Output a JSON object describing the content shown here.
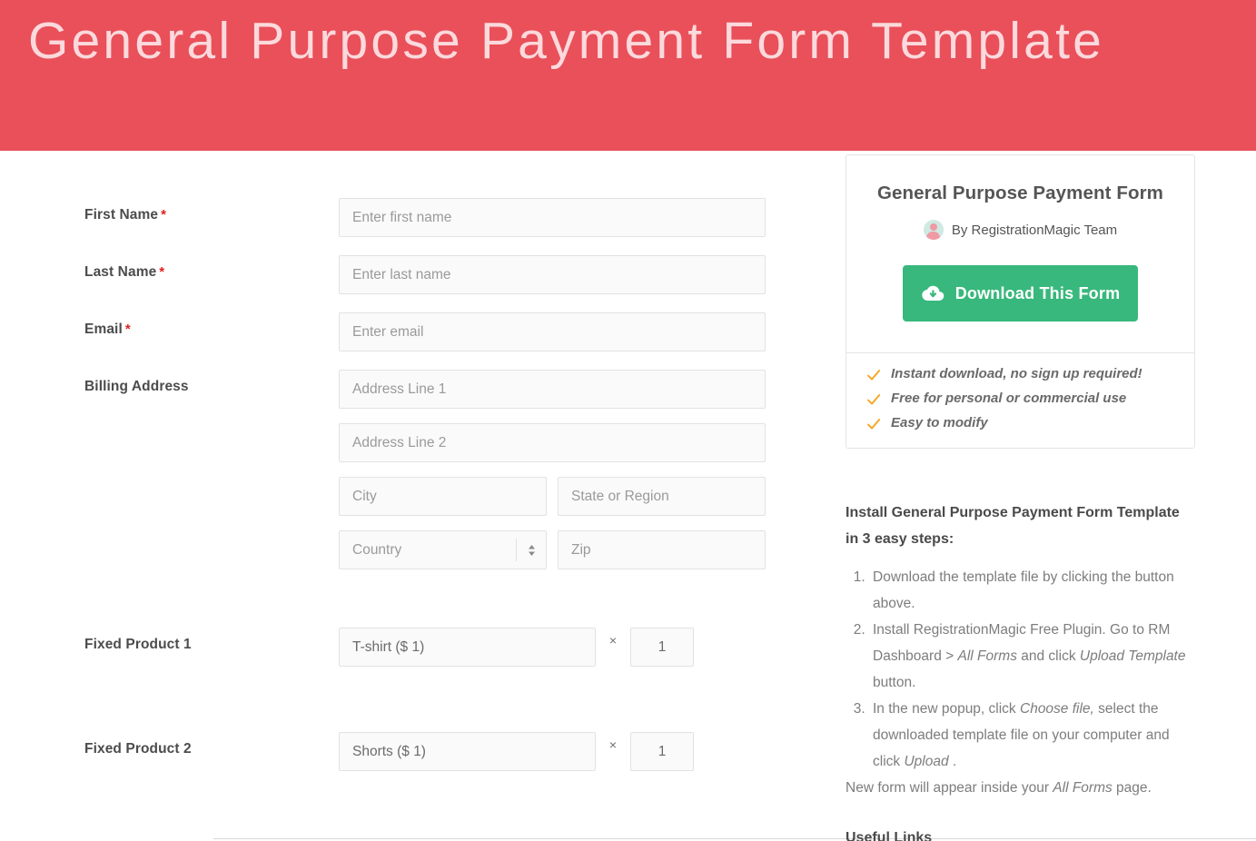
{
  "banner": {
    "title": "General Purpose Payment Form Template",
    "bg_color": "#e9505a",
    "text_color": "#fbd9dc"
  },
  "form": {
    "fields": [
      {
        "label": "First Name",
        "required": true,
        "placeholder": "Enter first name"
      },
      {
        "label": "Last Name",
        "required": true,
        "placeholder": "Enter last name"
      },
      {
        "label": "Email",
        "required": true,
        "placeholder": "Enter email"
      }
    ],
    "billing": {
      "label": "Billing Address",
      "address1_placeholder": "Address Line 1",
      "address2_placeholder": "Address Line 2",
      "city_placeholder": "City",
      "state_placeholder": "State or Region",
      "country_placeholder": "Country",
      "zip_placeholder": "Zip"
    },
    "products": [
      {
        "label": "Fixed Product 1",
        "item": "T-shirt ($ 1)",
        "times": "×",
        "qty": "1"
      },
      {
        "label": "Fixed Product 2",
        "item": "Shorts ($ 1)",
        "times": "×",
        "qty": "1"
      }
    ],
    "required_marker": "*"
  },
  "sidebar": {
    "card_title": "General Purpose Payment Form",
    "byline": "By RegistrationMagic Team",
    "download_label": "Download This Form",
    "download_color": "#38b87c",
    "check_color": "#f5a623",
    "features": [
      "Instant download, no sign up required!",
      "Free for personal or commercial use",
      "Easy to modify"
    ],
    "instructions_heading": "Install General Purpose Payment Form Template in 3 easy steps:",
    "steps": [
      "Download the template file by clicking the button above.",
      "Install RegistrationMagic Free Plugin. Go to RM Dashboard > All Forms and click Upload Template button.",
      "In the new popup, click Choose file, select the downloaded template file on your computer and click Upload ."
    ],
    "outro": "New form will appear inside your All Forms page.",
    "cut_off_heading": "Useful Links"
  }
}
